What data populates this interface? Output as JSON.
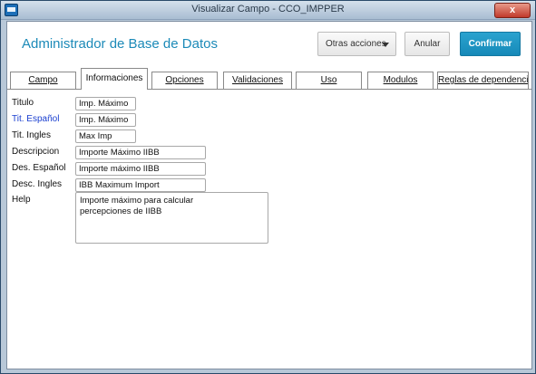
{
  "window": {
    "title": "Visualizar Campo - CCO_IMPPER",
    "close_label": "x"
  },
  "header": {
    "title": "Administrador de Base de Datos",
    "otras_acciones": "Otras acciones",
    "anular": "Anular",
    "confirmar": "Confirmar"
  },
  "tabs": [
    {
      "label": "Campo"
    },
    {
      "label": "Informaciones"
    },
    {
      "label": "Opciones"
    },
    {
      "label": "Validaciones"
    },
    {
      "label": "Uso"
    },
    {
      "label": "Modulos"
    },
    {
      "label": "Reglas de dependencia"
    }
  ],
  "form": {
    "titulo": {
      "label": "Titulo",
      "value": "Imp. Máximo"
    },
    "tit_espanol": {
      "label": "Tit. Español",
      "value": "Imp. Máximo"
    },
    "tit_ingles": {
      "label": "Tit. Ingles",
      "value": "Max Imp"
    },
    "descripcion": {
      "label": "Descripcion",
      "value": "Importe Máximo IIBB"
    },
    "des_espanol": {
      "label": "Des. Español",
      "value": "Importe máximo IIBB"
    },
    "desc_ingles": {
      "label": "Desc. Ingles",
      "value": "IBB Maximum Import"
    },
    "help": {
      "label": "Help",
      "value": "Importe máximo para calcular\npercepciones de IIBB"
    }
  },
  "colors": {
    "accent": "#1c8ab8",
    "confirm": "#1689b8",
    "highlight_label": "#1a3fd0"
  }
}
